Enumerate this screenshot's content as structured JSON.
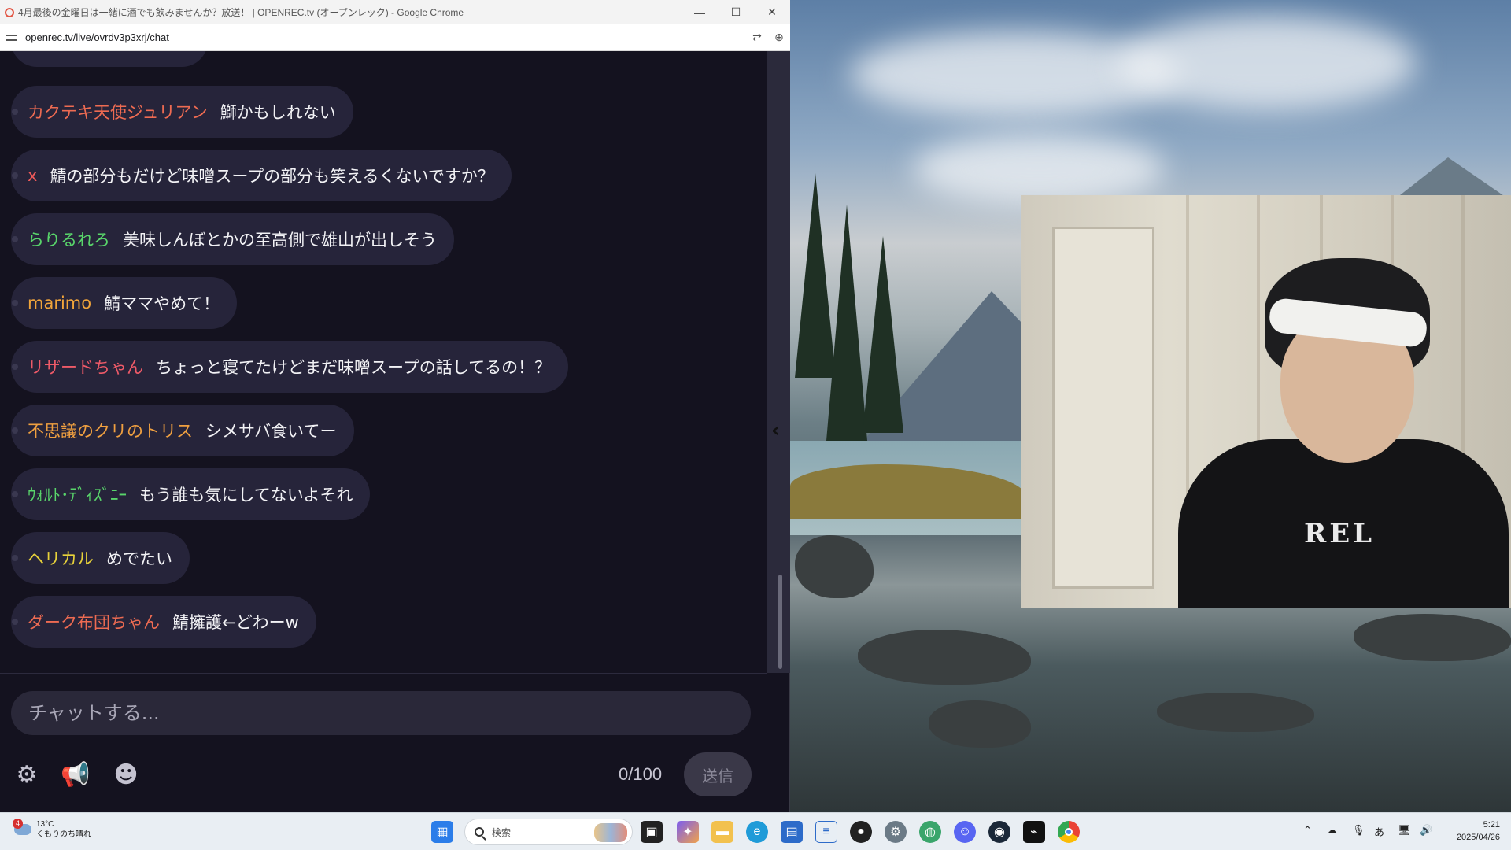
{
  "browser": {
    "title": "4月最後の金曜日は一緒に酒でも飲みませんか？放送！ | OPENREC.tv (オープンレック) - Google Chrome",
    "url": "openrec.tv/live/ovrdv3p3xrj/chat",
    "minimize": "—",
    "maximize": "☐",
    "close": "✕"
  },
  "chat": {
    "messages": [
      {
        "user": "カクテキ天使ジュリアン",
        "text": "鰤かもしれない",
        "color": "#ee6b52"
      },
      {
        "user": "x",
        "text": "鯖の部分もだけど味噌スープの部分も笑えるくないですか？",
        "color": "#ee5a5a"
      },
      {
        "user": "らりるれろ",
        "text": "美味しんぼとかの至高側で雄山が出しそう",
        "color": "#59d66b"
      },
      {
        "user": "marimo",
        "text": "鯖ママやめて！",
        "color": "#f0a43a"
      },
      {
        "user": "リザードちゃん",
        "text": "ちょっと寝てたけどまだ味噌スープの話してるの！？",
        "color": "#ee5a68"
      },
      {
        "user": "不思議のクリのトリス",
        "text": "シメサバ食いてー",
        "color": "#f0a040"
      },
      {
        "user": "ｳｫﾙﾄ･ﾃﾞｨｽﾞﾆｰ",
        "text": "もう誰も気にしてないよそれ",
        "color": "#59d66b"
      },
      {
        "user": "ヘリカル",
        "text": "めでたい",
        "color": "#e8d23a"
      },
      {
        "user": "ダーク布団ちゃん",
        "text": "鯖擁護←どわーw",
        "color": "#ee6b52"
      }
    ],
    "placeholder": "チャットする...",
    "counter": "0/100",
    "send_label": "送信"
  },
  "taskbar": {
    "weather_temp": "13°C",
    "weather_desc": "くもりのち晴れ",
    "weather_badge": "4",
    "search_placeholder": "検索",
    "ime": "あ",
    "time": "5:21",
    "date": "2025/04/26"
  }
}
